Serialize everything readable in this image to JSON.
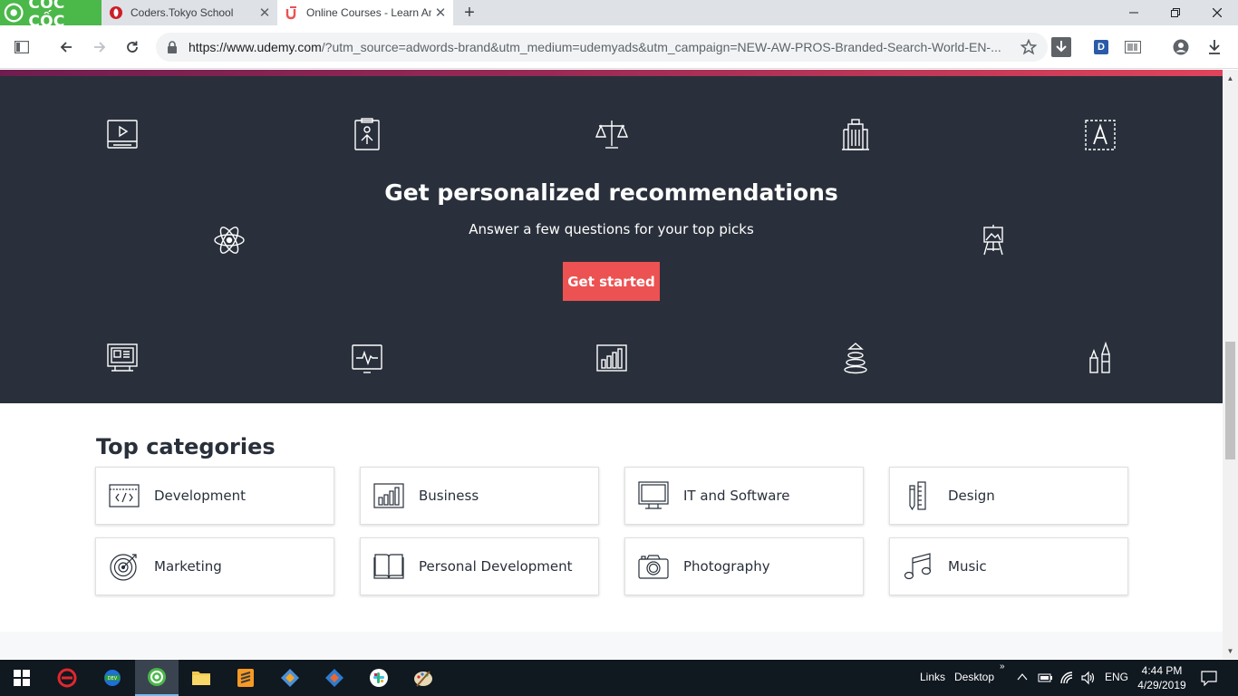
{
  "browser": {
    "brand": "CỐC CỐC",
    "tabs": [
      {
        "title": "Coders.Tokyo School",
        "favicon": "opera-favicon",
        "active": false
      },
      {
        "title": "Online Courses - Learn An",
        "favicon": "udemy-favicon",
        "active": true
      }
    ],
    "url_host": "https://www.udemy.com",
    "url_rest": "/?utm_source=adwords-brand&utm_medium=udemyads&utm_campaign=NEW-AW-PROS-Branded-Search-World-EN-...",
    "extension_label": "D"
  },
  "hero": {
    "title": "Get personalized recommendations",
    "subtitle": "Answer a few questions for your top picks",
    "cta": "Get started",
    "icons": [
      "video-lesson-icon",
      "clipboard-icon",
      "scales-icon",
      "building-icon",
      "typography-icon",
      "atom-icon",
      "easel-icon",
      "presentation-icon",
      "pulse-monitor-icon",
      "bar-chart-icon",
      "stacked-stones-icon",
      "paint-tools-icon"
    ]
  },
  "categories": {
    "title": "Top categories",
    "items": [
      {
        "label": "Development",
        "icon": "code-window-icon"
      },
      {
        "label": "Business",
        "icon": "bar-chart-icon"
      },
      {
        "label": "IT and Software",
        "icon": "monitor-icon"
      },
      {
        "label": "Design",
        "icon": "ruler-pencil-icon"
      },
      {
        "label": "Marketing",
        "icon": "target-icon"
      },
      {
        "label": "Personal Development",
        "icon": "book-icon"
      },
      {
        "label": "Photography",
        "icon": "camera-icon"
      },
      {
        "label": "Music",
        "icon": "music-note-icon"
      }
    ]
  },
  "taskbar": {
    "links": "Links",
    "desktop": "Desktop",
    "lang": "ENG",
    "time": "4:44 PM",
    "date": "4/29/2019"
  },
  "colors": {
    "hero_bg": "#29303b",
    "cta": "#ec5252",
    "brand_green": "#4bb84a"
  }
}
